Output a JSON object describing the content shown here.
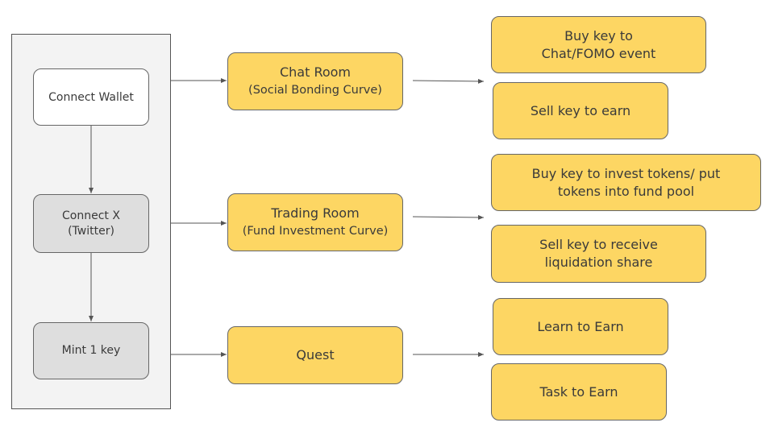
{
  "colors": {
    "accent": "#fdd663",
    "container": "#f3f3f3",
    "gray_node": "#dedede",
    "line": "#555555"
  },
  "steps": {
    "connect_wallet": "Connect Wallet",
    "connect_x": "Connect X",
    "connect_x_sub": "(Twitter)",
    "mint": "Mint 1 key"
  },
  "rooms": {
    "chat": {
      "title": "Chat Room",
      "subtitle": "(Social Bonding Curve)"
    },
    "trading": {
      "title": "Trading Room",
      "subtitle": "(Fund Investment Curve)"
    },
    "quest": {
      "title": "Quest"
    }
  },
  "actions": {
    "chat_buy_1": "Buy key to",
    "chat_buy_2": "Chat/FOMO event",
    "chat_sell": "Sell key to earn",
    "trade_buy_1": "Buy key to invest tokens/ put",
    "trade_buy_2": "tokens into fund pool",
    "trade_sell_1": "Sell key to receive",
    "trade_sell_2": "liquidation share",
    "learn": "Learn to Earn",
    "task": "Task to Earn"
  }
}
